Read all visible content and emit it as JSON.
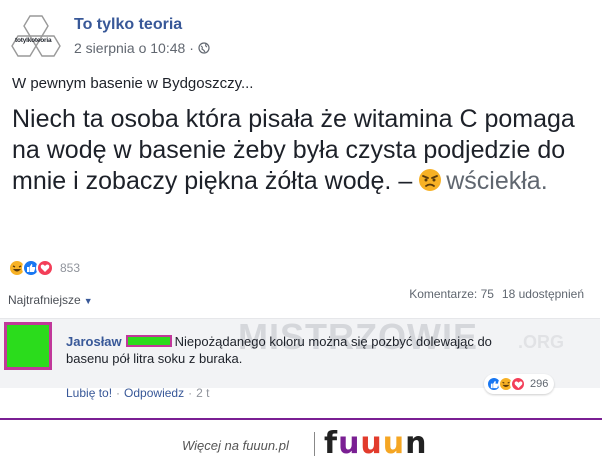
{
  "post": {
    "page_name": "To tylko teoria",
    "avatar_text": "totylkoteoria",
    "date": "2 sierpnia o 10:48 ·",
    "intro": "W pewnym basenie w Bydgoszczy...",
    "main_text": "Niech  ta osoba która pisała że witamina C pomaga na wodę w basenie żeby była czysta podjedzie do mnie i zobaczy piękna żółta wodę. –",
    "feeling": "wściekła."
  },
  "reactions": {
    "count": "853"
  },
  "comments_bar": {
    "sort_label": "Najtrafniejsze",
    "comments_count": "Komentarze: 75",
    "shares_count": "18 udostępnień"
  },
  "comment": {
    "author": "Jarosław",
    "text": "Niepożądanego koloru można się pozbyć dolewając do basenu pół litra soku z buraka.",
    "like_label": "Lubię to!",
    "reply_label": "Odpowiedz",
    "separator": "·",
    "time": "2 t",
    "reaction_count": "296"
  },
  "watermark": {
    "text": "MISTRZOWIE",
    "suffix": ".ORG"
  },
  "footer": {
    "tagline": "Więcej na fuuun.pl",
    "logo_letters": [
      "f",
      "u",
      "u",
      "u",
      "n"
    ]
  },
  "colors": {
    "link_blue": "#385898",
    "like_blue": "#1877f2",
    "love_red": "#f33e58",
    "haha_yellow": "#f7b125",
    "censor_green": "#2bdc1c",
    "censor_border": "#c1389a",
    "footer_purple": "#7a1f93",
    "logo_f": "#222222",
    "logo_u1": "#7a1f93",
    "logo_u2": "#e23b2c",
    "logo_u3": "#f5a623",
    "logo_n": "#222222"
  },
  "icons": [
    "globe-icon",
    "angry-emoji-icon",
    "haha-reaction-icon",
    "like-reaction-icon",
    "love-reaction-icon",
    "caret-down-icon"
  ]
}
